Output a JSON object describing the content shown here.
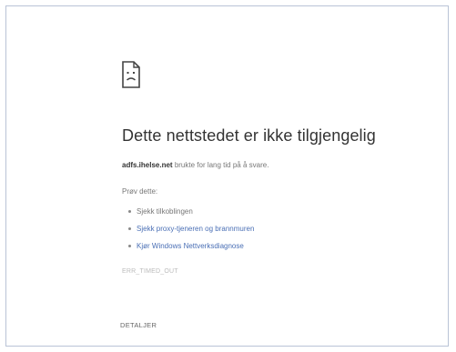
{
  "icon": "sad-page-icon",
  "colors": {
    "frame_border": "#b9c3d6",
    "title": "#333333",
    "text": "#777777",
    "link": "#4a6fb5",
    "error_code": "#bbbbbb"
  },
  "error": {
    "title": "Dette nettstedet er ikke tilgjengelig",
    "host": "adfs.ihelse.net",
    "message": "brukte for lang tid på å svare.",
    "try_heading": "Prøv dette:",
    "suggestions": [
      {
        "text": "Sjekk tilkoblingen",
        "link": false
      },
      {
        "text": "Sjekk proxy-tjeneren og brannmuren",
        "link": true
      },
      {
        "text": "Kjør Windows Nettverksdiagnose",
        "link": true
      }
    ],
    "code": "ERR_TIMED_OUT",
    "details_label": "DETALJER"
  }
}
